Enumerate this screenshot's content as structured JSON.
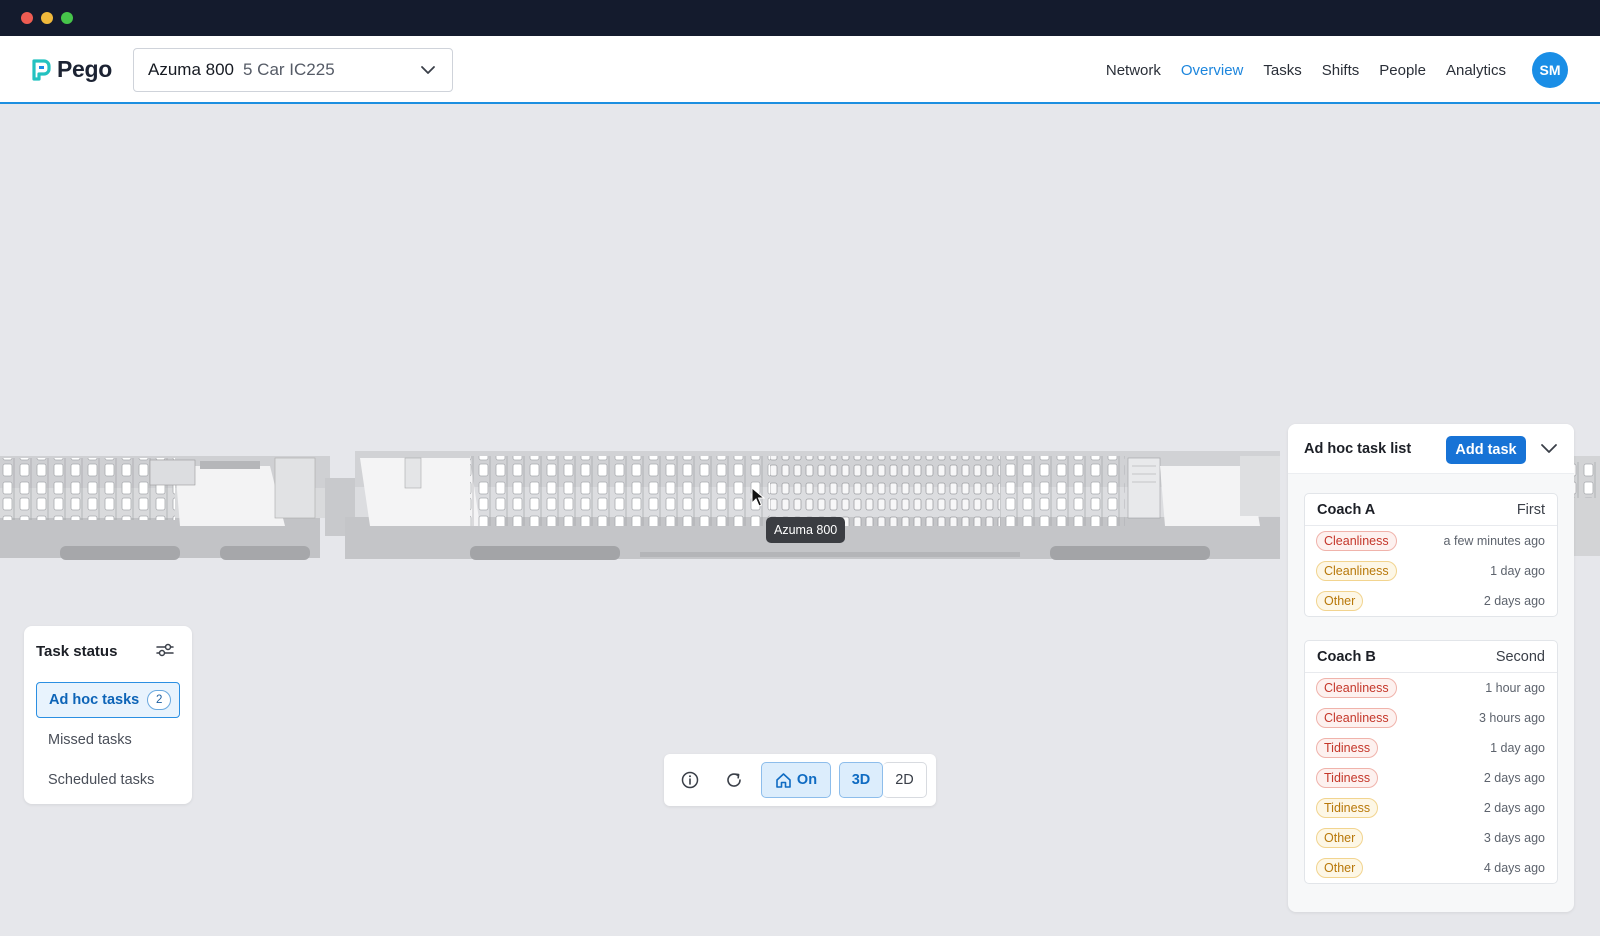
{
  "app": {
    "name": "Pego"
  },
  "selector": {
    "name": "Azuma 800",
    "sub": "5 Car IC225"
  },
  "nav": {
    "items": [
      {
        "label": "Network",
        "active": false
      },
      {
        "label": "Overview",
        "active": true
      },
      {
        "label": "Tasks",
        "active": false
      },
      {
        "label": "Shifts",
        "active": false
      },
      {
        "label": "People",
        "active": false
      },
      {
        "label": "Analytics",
        "active": false
      }
    ],
    "avatar": "SM"
  },
  "viewport": {
    "tooltip": "Azuma 800"
  },
  "task_status": {
    "title": "Task status",
    "items": [
      {
        "label": "Ad hoc tasks",
        "count": "2",
        "active": true
      },
      {
        "label": "Missed tasks",
        "active": false
      },
      {
        "label": "Scheduled tasks",
        "active": false
      }
    ]
  },
  "toolbar": {
    "home_label": "On",
    "view_3d": "3D",
    "view_2d": "2D"
  },
  "adhoc": {
    "title": "Ad hoc task list",
    "add_label": "Add task",
    "coaches": [
      {
        "name": "Coach A",
        "class": "First",
        "tasks": [
          {
            "tag": "Cleanliness",
            "tone": "red",
            "time": "a few minutes ago"
          },
          {
            "tag": "Cleanliness",
            "tone": "amber",
            "time": "1 day ago"
          },
          {
            "tag": "Other",
            "tone": "amber",
            "time": "2 days ago"
          }
        ]
      },
      {
        "name": "Coach B",
        "class": "Second",
        "tasks": [
          {
            "tag": "Cleanliness",
            "tone": "red",
            "time": "1 hour ago"
          },
          {
            "tag": "Cleanliness",
            "tone": "red",
            "time": "3 hours ago"
          },
          {
            "tag": "Tidiness",
            "tone": "red",
            "time": "1 day ago"
          },
          {
            "tag": "Tidiness",
            "tone": "red",
            "time": "2 days ago"
          },
          {
            "tag": "Tidiness",
            "tone": "amber",
            "time": "2 days ago"
          },
          {
            "tag": "Other",
            "tone": "amber",
            "time": "3 days ago"
          },
          {
            "tag": "Other",
            "tone": "amber",
            "time": "4 days ago"
          }
        ]
      }
    ]
  },
  "colors": {
    "accent": "#1773d6",
    "nav_active": "#1d86dd",
    "header_bg": "#141b2d",
    "canvas_bg": "#e6e7eb"
  }
}
